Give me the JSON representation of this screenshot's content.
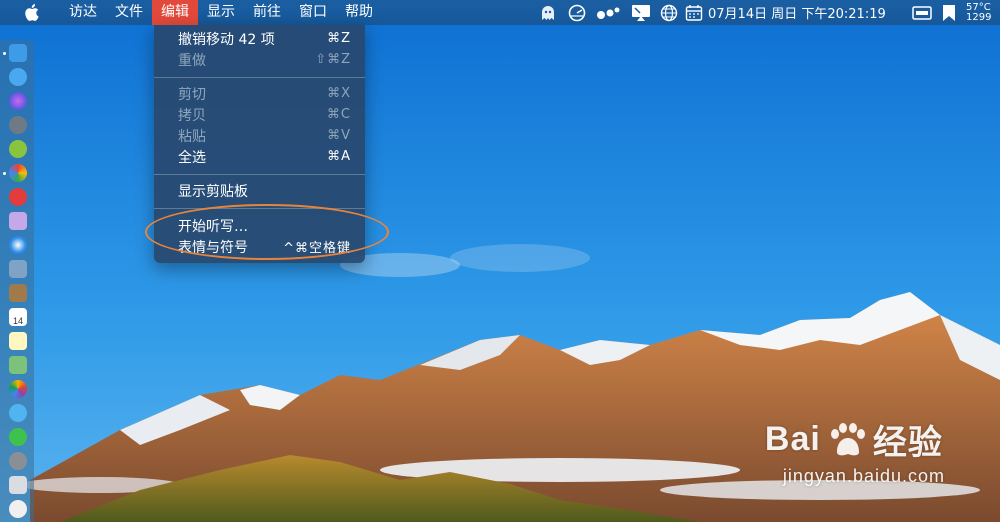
{
  "menubar": {
    "items": [
      "访达",
      "文件",
      "编辑",
      "显示",
      "前往",
      "窗口",
      "帮助"
    ],
    "active_index": 2,
    "clock": "07月14日 周日 下午20:21:19",
    "temperature": "57°C",
    "rpm": "1299"
  },
  "edit_menu": {
    "items": [
      {
        "label": "撤销移动 42 项",
        "shortcut": "⌘Z",
        "enabled": true
      },
      {
        "label": "重做",
        "shortcut": "⇧⌘Z",
        "enabled": false
      },
      {
        "label": "剪切",
        "shortcut": "⌘X",
        "enabled": false
      },
      {
        "label": "拷贝",
        "shortcut": "⌘C",
        "enabled": false
      },
      {
        "label": "粘贴",
        "shortcut": "⌘V",
        "enabled": false
      },
      {
        "label": "全选",
        "shortcut": "⌘A",
        "enabled": true
      },
      {
        "label": "显示剪贴板",
        "shortcut": "",
        "enabled": true
      },
      {
        "label": "开始听写…",
        "shortcut": "",
        "enabled": true
      },
      {
        "label": "表情与符号",
        "shortcut": "^⌘空格键",
        "enabled": true
      }
    ]
  },
  "dock": {
    "calendar_day": "14"
  },
  "watermark": {
    "brand": "Bai",
    "suffix": "经验",
    "url": "jingyan.baidu.com"
  },
  "colors": {
    "menubar": "#16589a",
    "active_menu": "#e2493b",
    "highlight_oval": "#e8843a"
  }
}
